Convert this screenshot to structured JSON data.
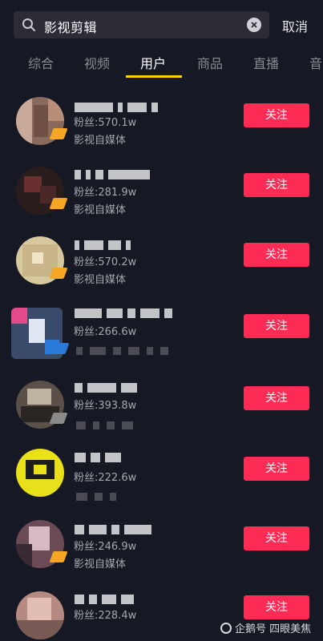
{
  "search": {
    "query": "影视剪辑",
    "cancel_label": "取消"
  },
  "tabs": [
    {
      "label": "综合"
    },
    {
      "label": "视频"
    },
    {
      "label": "用户"
    },
    {
      "label": "商品"
    },
    {
      "label": "直播"
    },
    {
      "label": "音"
    }
  ],
  "active_tab": "用户",
  "results": [
    {
      "fans": "粉丝:570.1w",
      "desc": "影视自媒体",
      "follow_label": "关注"
    },
    {
      "fans": "粉丝:281.9w",
      "desc": "影视自媒体",
      "follow_label": "关注"
    },
    {
      "fans": "粉丝:570.2w",
      "desc": "影视自媒体",
      "follow_label": "关注"
    },
    {
      "fans": "粉丝:266.6w",
      "desc": "",
      "follow_label": "关注"
    },
    {
      "fans": "粉丝:393.8w",
      "desc": "",
      "follow_label": "关注"
    },
    {
      "fans": "粉丝:222.6w",
      "desc": "",
      "follow_label": "关注"
    },
    {
      "fans": "粉丝:246.9w",
      "desc": "影视自媒体",
      "follow_label": "关注"
    },
    {
      "fans": "粉丝:228.4w",
      "desc": "",
      "follow_label": "关注"
    }
  ],
  "watermark": "企鹅号 四眼美焦",
  "colors": {
    "background": "#161823",
    "follow_button": "#fe2c55",
    "tab_indicator": "#ffd400"
  }
}
